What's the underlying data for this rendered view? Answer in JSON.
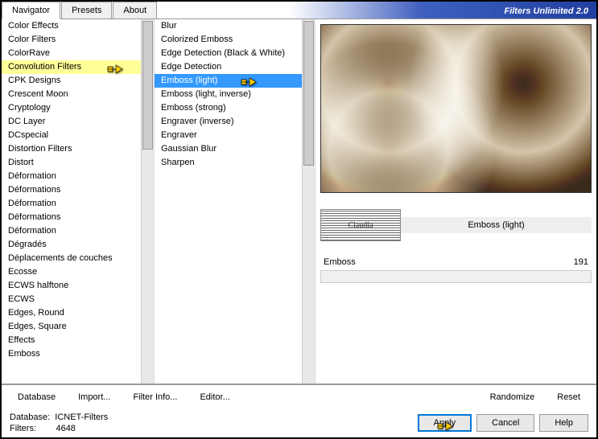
{
  "tabs": {
    "navigator": "Navigator",
    "presets": "Presets",
    "about": "About"
  },
  "title": "Filters Unlimited 2.0",
  "categories": [
    "Color Effects",
    "Color Filters",
    "ColorRave",
    "Convolution Filters",
    "CPK Designs",
    "Crescent Moon",
    "Cryptology",
    "DC Layer",
    "DCspecial",
    "Distortion Filters",
    "Distort",
    "Déformation",
    "Déformations",
    "Déformation",
    "Déformations",
    "Déformation",
    "Dégradés",
    "Déplacements de couches",
    "Ecosse",
    "ECWS halftone",
    "ECWS",
    "Edges, Round",
    "Edges, Square",
    "Effects",
    "Emboss"
  ],
  "selected_category_index": 3,
  "filters": [
    "Blur",
    "Colorized Emboss",
    "Edge Detection (Black & White)",
    "Edge Detection",
    "Emboss (light)",
    "Emboss (light, inverse)",
    "Emboss (strong)",
    "Engraver (inverse)",
    "Engraver",
    "Gaussian Blur",
    "Sharpen"
  ],
  "selected_filter_index": 4,
  "selected_filter_name": "Emboss (light)",
  "watermark_text": "Claudia",
  "params": {
    "emboss": {
      "label": "Emboss",
      "value": "191"
    }
  },
  "buttons": {
    "database": "Database",
    "import": "Import...",
    "filterinfo": "Filter Info...",
    "editor": "Editor...",
    "randomize": "Randomize",
    "reset": "Reset",
    "apply": "Apply",
    "cancel": "Cancel",
    "help": "Help"
  },
  "status": {
    "db_label": "Database:",
    "db_value": "ICNET-Filters",
    "filters_label": "Filters:",
    "filters_value": "4648"
  }
}
